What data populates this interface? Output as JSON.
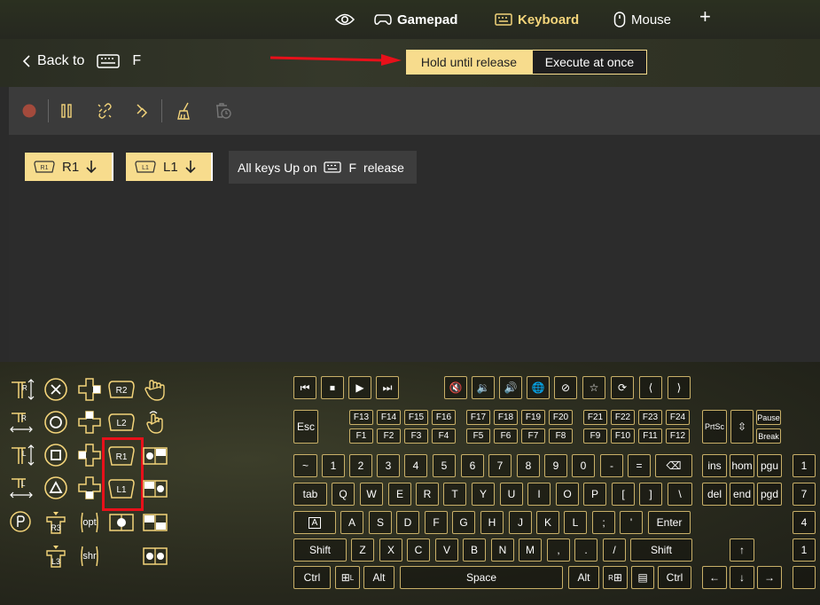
{
  "tabs": {
    "gamepad": "Gamepad",
    "keyboard": "Keyboard",
    "mouse": "Mouse",
    "add": "+"
  },
  "nav": {
    "back": "Back to",
    "key": "F"
  },
  "mode": {
    "hold": "Hold until release",
    "execute": "Execute at once"
  },
  "chips": {
    "r1": "R1",
    "l1": "L1",
    "r1_badge": "R1",
    "l1_badge": "L1",
    "release_prefix": "All keys Up on",
    "release_key": "F",
    "release_suffix": "release"
  },
  "gamepad_labels": {
    "r2": "R2",
    "l2": "L2",
    "r1": "R1",
    "l1": "L1",
    "r": "R",
    "l": "L",
    "r3": "R3",
    "l3": "L3",
    "opt": "opt",
    "shr": "shr"
  },
  "keys": {
    "esc": "Esc",
    "f": [
      "F13",
      "F14",
      "F15",
      "F16",
      "F17",
      "F18",
      "F19",
      "F20",
      "F21",
      "F22",
      "F23",
      "F24"
    ],
    "fl": [
      "F1",
      "F2",
      "F3",
      "F4",
      "F5",
      "F6",
      "F7",
      "F8",
      "F9",
      "F10",
      "F11",
      "F12"
    ],
    "prtsc": "PrtSc",
    "pause": "Pause",
    "brk": "Break",
    "num_row": [
      "~",
      "1",
      "2",
      "3",
      "4",
      "5",
      "6",
      "7",
      "8",
      "9",
      "0",
      "-",
      "="
    ],
    "tab": "tab",
    "q_row": [
      "Q",
      "W",
      "E",
      "R",
      "T",
      "Y",
      "U",
      "I",
      "O",
      "P",
      "[",
      "]",
      "\\"
    ],
    "a_row": [
      "A",
      "S",
      "D",
      "F",
      "G",
      "H",
      "J",
      "K",
      "L",
      ";",
      "'"
    ],
    "enter": "Enter",
    "shift": "Shift",
    "z_row": [
      "Z",
      "X",
      "C",
      "V",
      "B",
      "N",
      "M",
      ",",
      ".",
      "/"
    ],
    "ctrl": "Ctrl",
    "alt": "Alt",
    "space": "Space",
    "caps_a": "A",
    "win_l": "L",
    "win_r": "R",
    "nav": [
      "ins",
      "hom",
      "pgu",
      "del",
      "end",
      "pgd"
    ],
    "numpad": [
      "1",
      "7",
      "4",
      "1"
    ]
  }
}
